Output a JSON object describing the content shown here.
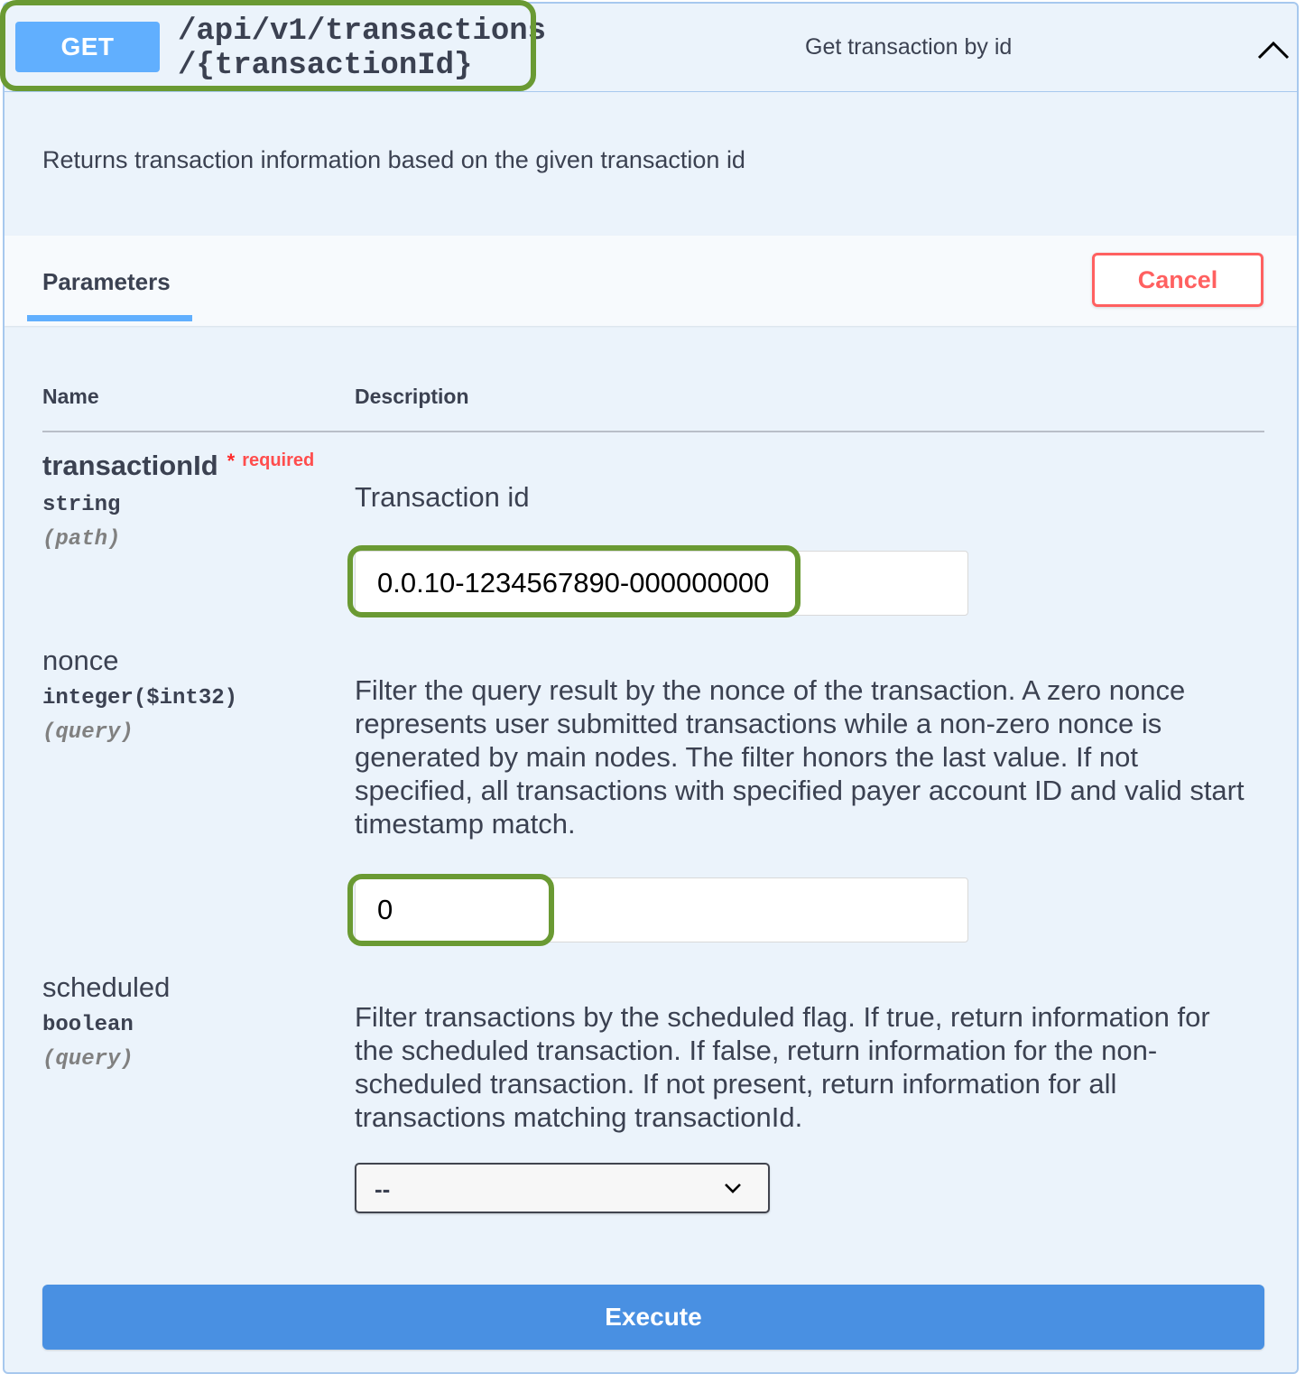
{
  "summary": {
    "method": "GET",
    "path_line1": "/api/v1/transactions",
    "path_line2": "/{transactionId}",
    "description": "Get transaction by id"
  },
  "operation": {
    "description": "Returns transaction information based on the given transaction id"
  },
  "parameters_section": {
    "tab_label": "Parameters",
    "cancel_label": "Cancel",
    "columns": [
      "Name",
      "Description"
    ]
  },
  "parameters": [
    {
      "name": "transactionId",
      "required_marker": "*",
      "required_label": "required",
      "type": "string",
      "in": "(path)",
      "description": "Transaction id",
      "value": "0.0.10-1234567890-000000000"
    },
    {
      "name": "nonce",
      "type": "integer($int32)",
      "in": "(query)",
      "description": "Filter the query result by the nonce of the transaction. A zero nonce represents user submitted transactions while a non-zero nonce is generated by main nodes. The filter honors the last value. If not specified, all transactions with specified payer account ID and valid start timestamp match.",
      "value": "0"
    },
    {
      "name": "scheduled",
      "type": "boolean",
      "in": "(query)",
      "description": "Filter transactions by the scheduled flag. If true, return information for the scheduled transaction. If false, return information for the non-scheduled transaction. If not present, return information for all transactions matching transactionId.",
      "selected": "--"
    }
  ],
  "execute_label": "Execute",
  "colors": {
    "get_method": "#61affe",
    "panel_background": "#ebf3fb",
    "panel_border": "#a7c8ee",
    "cancel": "#ff6060",
    "execute": "#4990e2",
    "highlight": "#6a9a33"
  },
  "icons": {
    "collapse": "chevron-up-icon",
    "dropdown": "chevron-down-icon"
  }
}
